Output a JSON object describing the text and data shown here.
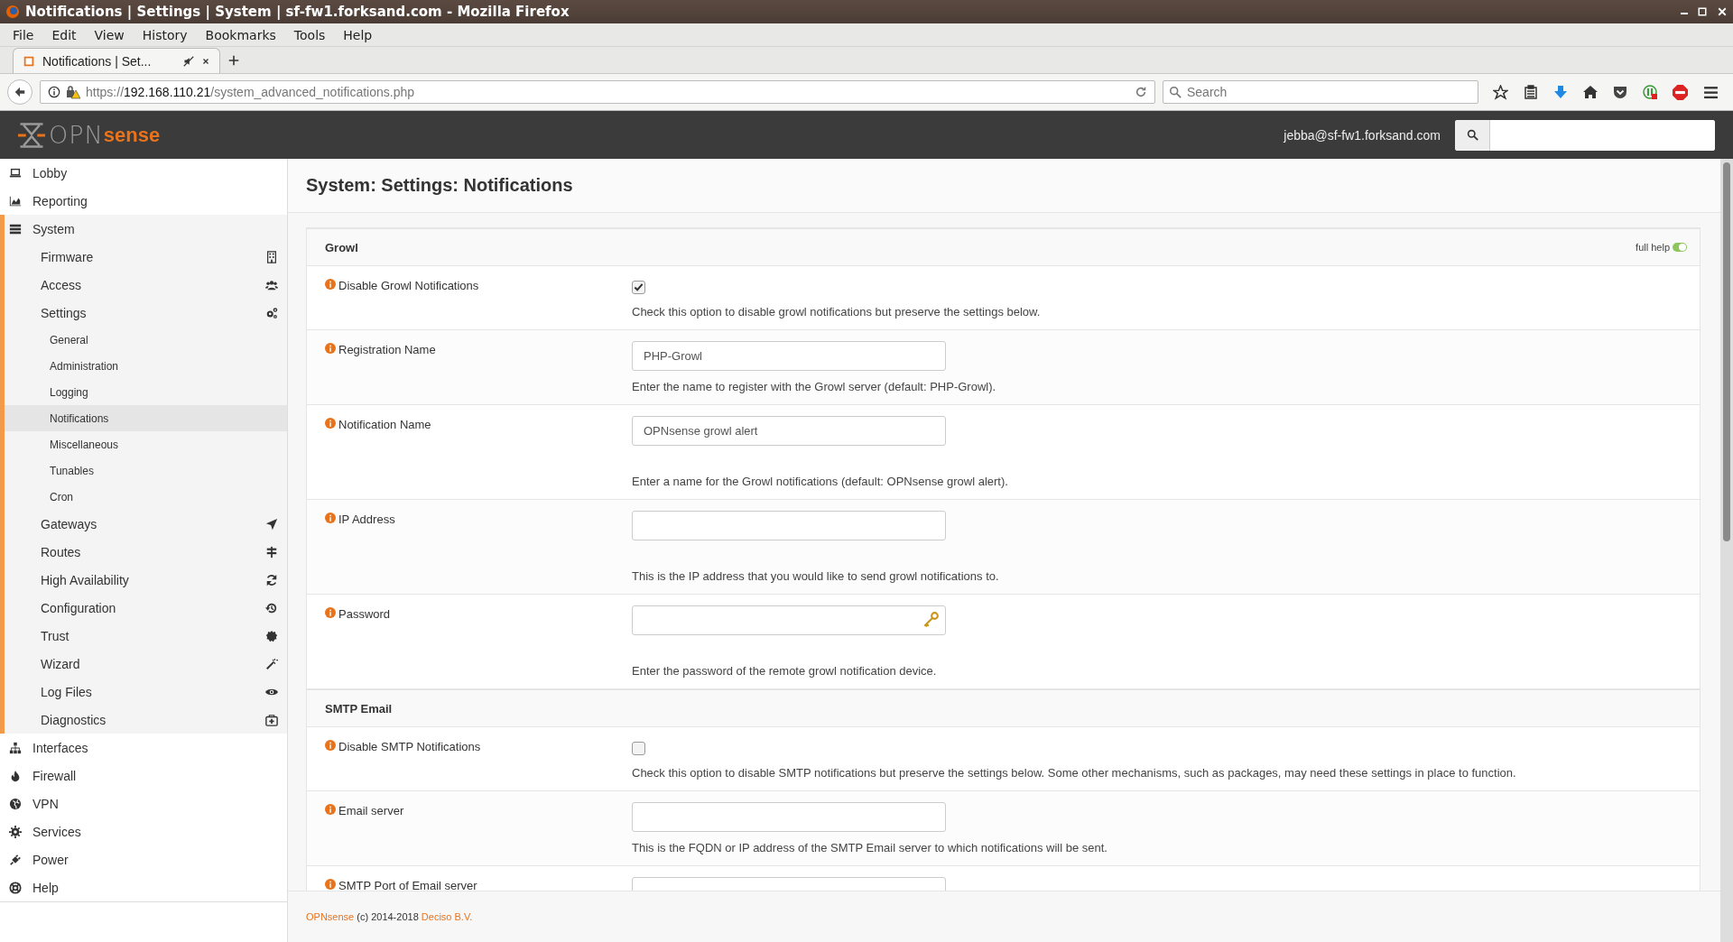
{
  "window": {
    "title": "Notifications | Settings | System | sf-fw1.forksand.com - Mozilla Firefox"
  },
  "menu": [
    "File",
    "Edit",
    "View",
    "History",
    "Bookmarks",
    "Tools",
    "Help"
  ],
  "tabs": [
    {
      "label": "Notifications | Set...",
      "selected": true
    }
  ],
  "address": {
    "scheme": "https://",
    "host": "192.168.110.21",
    "path": "/system_advanced_notifications.php"
  },
  "browser_search": {
    "placeholder": "Search"
  },
  "header": {
    "logo_main": "OPN",
    "logo_accent": "sense",
    "user": "jebba@sf-fw1.forksand.com"
  },
  "sidebar": {
    "items": [
      {
        "label": "Lobby",
        "selected": false
      },
      {
        "label": "Reporting",
        "selected": false
      },
      {
        "label": "System",
        "expanded": true,
        "selected": false,
        "children": [
          {
            "label": "Firmware",
            "selected": false
          },
          {
            "label": "Access",
            "selected": false
          },
          {
            "label": "Settings",
            "expanded": true,
            "selected": false,
            "children": [
              {
                "label": "General",
                "selected": false
              },
              {
                "label": "Administration",
                "selected": false
              },
              {
                "label": "Logging",
                "selected": false
              },
              {
                "label": "Notifications",
                "selected": true
              },
              {
                "label": "Miscellaneous",
                "selected": false
              },
              {
                "label": "Tunables",
                "selected": false
              },
              {
                "label": "Cron",
                "selected": false
              }
            ]
          },
          {
            "label": "Gateways",
            "selected": false
          },
          {
            "label": "Routes",
            "selected": false
          },
          {
            "label": "High Availability",
            "selected": false
          },
          {
            "label": "Configuration",
            "selected": false
          },
          {
            "label": "Trust",
            "selected": false
          },
          {
            "label": "Wizard",
            "selected": false
          },
          {
            "label": "Log Files",
            "selected": false
          },
          {
            "label": "Diagnostics",
            "selected": false
          }
        ]
      },
      {
        "label": "Interfaces",
        "selected": false
      },
      {
        "label": "Firewall",
        "selected": false
      },
      {
        "label": "VPN",
        "selected": false
      },
      {
        "label": "Services",
        "selected": false
      },
      {
        "label": "Power",
        "selected": false
      },
      {
        "label": "Help",
        "selected": false
      }
    ]
  },
  "page_title": "System: Settings: Notifications",
  "sections": [
    {
      "title": "Growl",
      "full_help": {
        "label": "full help",
        "on": true
      },
      "fields": [
        {
          "kind": "checkbox",
          "label": "Disable Growl Notifications",
          "checked": true,
          "help": "Check this option to disable growl notifications but preserve the settings below."
        },
        {
          "kind": "text",
          "label": "Registration Name",
          "value": "PHP-Growl",
          "help": "Enter the name to register with the Growl server (default: PHP-Growl)."
        },
        {
          "kind": "text",
          "label": "Notification Name",
          "value": "OPNsense growl alert",
          "help": "Enter a name for the Growl notifications (default: OPNsense growl alert)."
        },
        {
          "kind": "text",
          "label": "IP Address",
          "help": "This is the IP address that you would like to send growl notifications to."
        },
        {
          "kind": "password",
          "label": "Password",
          "help": "Enter the password of the remote growl notification device."
        }
      ]
    },
    {
      "title": "SMTP Email",
      "fields": [
        {
          "kind": "checkbox",
          "label": "Disable SMTP Notifications",
          "checked": false,
          "help": "Check this option to disable SMTP notifications but preserve the settings below. Some other mechanisms, such as packages, may need these settings in place to function."
        },
        {
          "kind": "text",
          "label": "Email server",
          "help": "This is the FQDN or IP address of the SMTP Email server to which notifications will be sent."
        },
        {
          "kind": "text",
          "label": "SMTP Port of Email server"
        }
      ]
    }
  ],
  "footer": {
    "brand": "OPNsense",
    "text": "(c) 2014-2018",
    "company": "Deciso B.V."
  }
}
